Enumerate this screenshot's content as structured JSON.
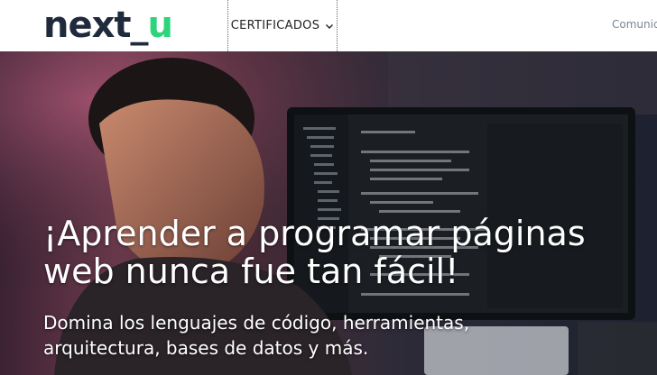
{
  "header": {
    "logo": {
      "next": "next",
      "underscore": "_",
      "u": "u"
    },
    "nav": {
      "certificados_label": "CERTIFICADOS",
      "comunidad_label": "Comunid"
    }
  },
  "hero": {
    "title_line1": "¡Aprender a programar páginas",
    "title_line2": "web nunca fue tan fácil!",
    "subtitle_line1": "Domina los lenguajes de código, herramientas,",
    "subtitle_line2": "arquitectura, bases de datos y más."
  },
  "colors": {
    "brand_dark": "#1f2a3c",
    "brand_green": "#2ed47a",
    "nav_text": "#222222",
    "nav_muted": "#7a8796"
  },
  "icons": {
    "chevron": "chevron-down-icon"
  }
}
